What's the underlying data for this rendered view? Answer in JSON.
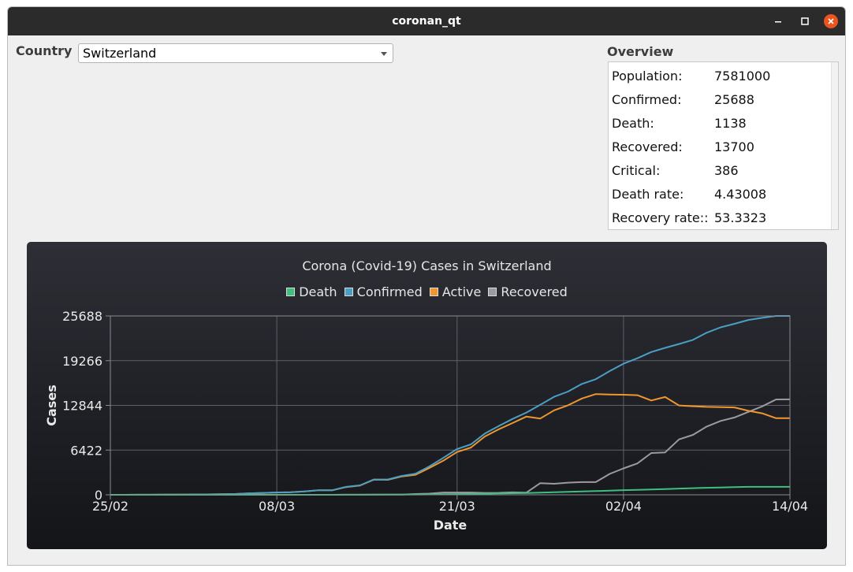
{
  "window": {
    "title": "coronan_qt"
  },
  "country": {
    "label": "Country",
    "selected": "Switzerland"
  },
  "overview": {
    "label": "Overview",
    "rows": [
      {
        "key": "Population:",
        "value": "7581000"
      },
      {
        "key": "Confirmed:",
        "value": "25688"
      },
      {
        "key": "Death:",
        "value": "1138"
      },
      {
        "key": "Recovered:",
        "value": "13700"
      },
      {
        "key": "Critical:",
        "value": "386"
      },
      {
        "key": "Death rate:",
        "value": "4.43008"
      },
      {
        "key": "Recovery rate::",
        "value": "53.3323"
      }
    ]
  },
  "chart_data": {
    "type": "line",
    "title": "Corona (Covid-19) Cases in Switzerland",
    "xlabel": "Date",
    "ylabel": "Cases",
    "x_ticks": [
      "25/02",
      "08/03",
      "21/03",
      "02/04",
      "14/04"
    ],
    "y_ticks": [
      "0",
      "6422",
      "12844",
      "19266",
      "25688"
    ],
    "ylim": [
      0,
      25688
    ],
    "xlim": [
      "2020-02-25",
      "2020-04-14"
    ],
    "grid": true,
    "legend_position": "top",
    "x": [
      "2020-02-25",
      "2020-02-26",
      "2020-02-27",
      "2020-02-28",
      "2020-02-29",
      "2020-03-01",
      "2020-03-02",
      "2020-03-03",
      "2020-03-04",
      "2020-03-05",
      "2020-03-06",
      "2020-03-07",
      "2020-03-08",
      "2020-03-09",
      "2020-03-10",
      "2020-03-11",
      "2020-03-12",
      "2020-03-13",
      "2020-03-14",
      "2020-03-15",
      "2020-03-16",
      "2020-03-17",
      "2020-03-18",
      "2020-03-19",
      "2020-03-20",
      "2020-03-21",
      "2020-03-22",
      "2020-03-23",
      "2020-03-24",
      "2020-03-25",
      "2020-03-26",
      "2020-03-27",
      "2020-03-28",
      "2020-03-29",
      "2020-03-30",
      "2020-03-31",
      "2020-04-01",
      "2020-04-02",
      "2020-04-03",
      "2020-04-04",
      "2020-04-05",
      "2020-04-06",
      "2020-04-07",
      "2020-04-08",
      "2020-04-09",
      "2020-04-10",
      "2020-04-11",
      "2020-04-12",
      "2020-04-13",
      "2020-04-14"
    ],
    "series": [
      {
        "name": "Death",
        "color": "#3fbf7f",
        "values": [
          0,
          0,
          0,
          0,
          0,
          0,
          0,
          0,
          1,
          1,
          1,
          1,
          2,
          2,
          3,
          4,
          4,
          11,
          13,
          14,
          27,
          28,
          41,
          56,
          80,
          98,
          120,
          153,
          191,
          231,
          264,
          300,
          359,
          433,
          488,
          536,
          591,
          666,
          715,
          765,
          821,
          895,
          948,
          1002,
          1036,
          1106,
          1138,
          1138,
          1138,
          1138
        ]
      },
      {
        "name": "Confirmed",
        "color": "#4b9ec4",
        "values": [
          1,
          1,
          8,
          8,
          18,
          27,
          42,
          56,
          90,
          114,
          214,
          268,
          337,
          374,
          491,
          652,
          652,
          1139,
          1359,
          2200,
          2200,
          2700,
          3028,
          4075,
          5294,
          6575,
          7245,
          8795,
          9877,
          10897,
          11811,
          12928,
          14076,
          14829,
          15922,
          16605,
          17768,
          18827,
          19606,
          20505,
          21100,
          21657,
          22253,
          23280,
          24051,
          24551,
          25107,
          25415,
          25688,
          25688
        ]
      },
      {
        "name": "Active",
        "color": "#f0962e",
        "values": [
          1,
          1,
          8,
          8,
          18,
          27,
          42,
          56,
          89,
          113,
          211,
          265,
          333,
          370,
          486,
          644,
          644,
          1114,
          1332,
          2168,
          2155,
          2640,
          2877,
          3852,
          4885,
          6144,
          6794,
          8369,
          9404,
          10313,
          11235,
          10953,
          12136,
          12858,
          13831,
          14462,
          14409,
          14374,
          14300,
          13543,
          14042,
          12834,
          12717,
          12629,
          12588,
          12545,
          12058,
          11702,
          11000,
          11000
        ]
      },
      {
        "name": "Recovered",
        "color": "#9a9aa0",
        "values": [
          0,
          0,
          0,
          0,
          0,
          0,
          0,
          0,
          0,
          0,
          2,
          2,
          2,
          2,
          2,
          4,
          4,
          14,
          14,
          18,
          18,
          32,
          110,
          167,
          329,
          333,
          333,
          273,
          282,
          353,
          312,
          1675,
          1581,
          1738,
          1823,
          1823,
          3000,
          3787,
          4500,
          6000,
          6087,
          7953,
          8600,
          9800,
          10600,
          11100,
          11900,
          12700,
          13688,
          13700
        ]
      }
    ]
  }
}
